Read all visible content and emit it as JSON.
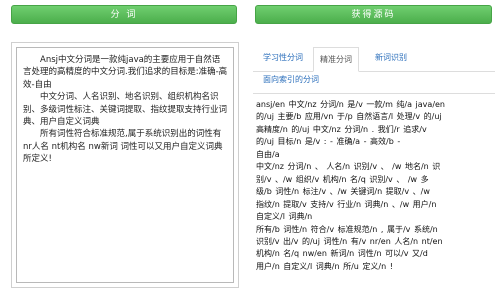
{
  "buttons": {
    "segment": "分 词",
    "get_source": "获得源码"
  },
  "input": {
    "paragraphs": [
      "Ansj中文分词是一款纯java的主要应用于自然语言处理的高精度的中文分词.我们追求的目标是:准确-高效-自由",
      "中文分词、人名识别、地名识别、组织机构名识别、多级词性标注、关键词提取、指纹提取支持行业词典、用户自定义词典",
      "所有词性符合标准规范,属于系统识别出的词性有 nr人名 nt机构名 nw新词 词性可以又用户自定义词典所定义!"
    ]
  },
  "tabs": [
    {
      "label": "学习性分词"
    },
    {
      "label": "精准分词"
    },
    {
      "label": "新词识别"
    },
    {
      "label": "面向索引的分词"
    }
  ],
  "results": [
    "ansj/en  中文/nz  分词/n  是/v  一款/m  纯/a  java/en",
    "的/uj  主要/b  应用/vn  于/p  自然语言/l  处理/v  的/uj",
    "高精度/n  的/uj  中文/nz  分词/n  .  我们/r  追求/v",
    "的/uj  目标/n  是/v  :  -  准确/a  -  高效/b  -",
    "自由/a",
    "中文/nz  分词/n  、  人名/n  识别/v  、  /w  地名/n  识",
    "别/v  、/w  组织/v  机构/n  名/q  识别/v  、  /w  多",
    "级/b  词性/n  标注/v  、/w  关键词/n  提取/v  、/w",
    "指纹/n  提取/v  支持/v  行业/n  词典/n  、/w  用户/n",
    "自定义/l  词典/n",
    "所有/b  词性/n  符合/v  标准规范/n  ,  属于/v  系统/n",
    "识别/v  出/v  的/uj  词性/n  有/v  nr/en  人名/n  nt/en",
    "机构/n  名/q  nw/en  新词/n  词性/n  可以/v  又/d",
    "用户/n  自定义/l  词典/n  所/u  定义/n  !"
  ]
}
